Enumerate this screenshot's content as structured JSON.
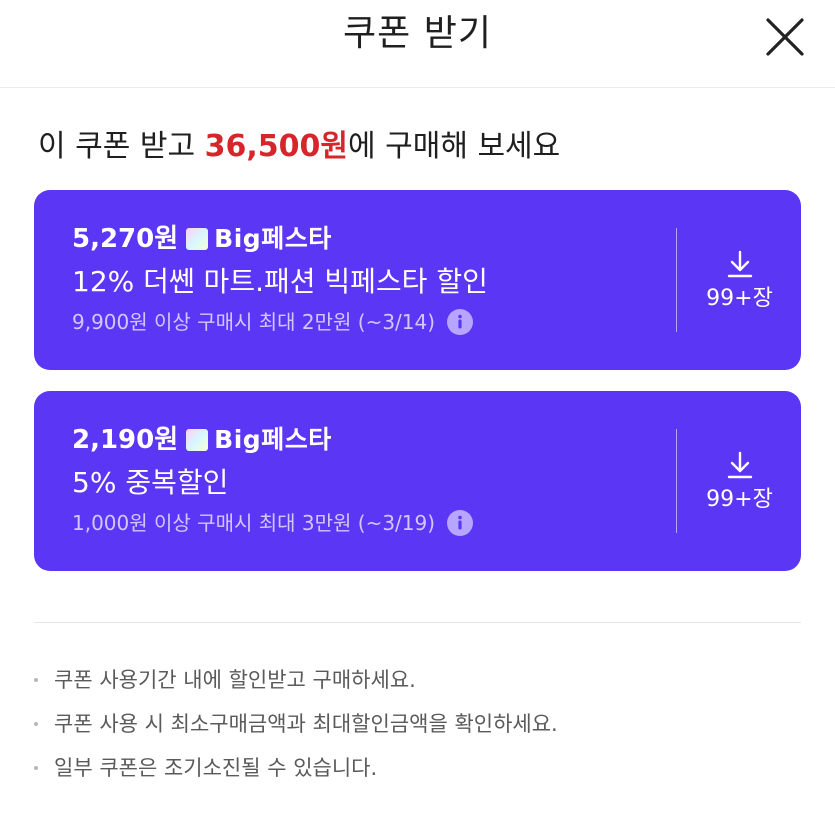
{
  "header": {
    "title": "쿠폰 받기",
    "close_icon": "close-icon"
  },
  "headline": {
    "prefix": "이 쿠폰 받고 ",
    "price": "36,500원",
    "suffix": "에 구매해 보세요"
  },
  "coupons": [
    {
      "amount": "5,270원",
      "badge": "Big페스타",
      "title": "12% 더쎈 마트.패션 빅페스타 할인",
      "condition": "9,900원 이상 구매시 최대 2만원 (~3/14)",
      "count": "99+장"
    },
    {
      "amount": "2,190원",
      "badge": "Big페스타",
      "title": "5% 중복할인",
      "condition": "1,000원 이상 구매시 최대 3만원 (~3/19)",
      "count": "99+장"
    }
  ],
  "notes": [
    "쿠폰 사용기간 내에 할인받고 구매하세요.",
    "쿠폰 사용 시 최소구매금액과 최대할인금액을 확인하세요.",
    "일부 쿠폰은 조기소진될 수 있습니다."
  ],
  "colors": {
    "coupon_bg": "#5b36f5",
    "price_accent": "#d7262b"
  }
}
